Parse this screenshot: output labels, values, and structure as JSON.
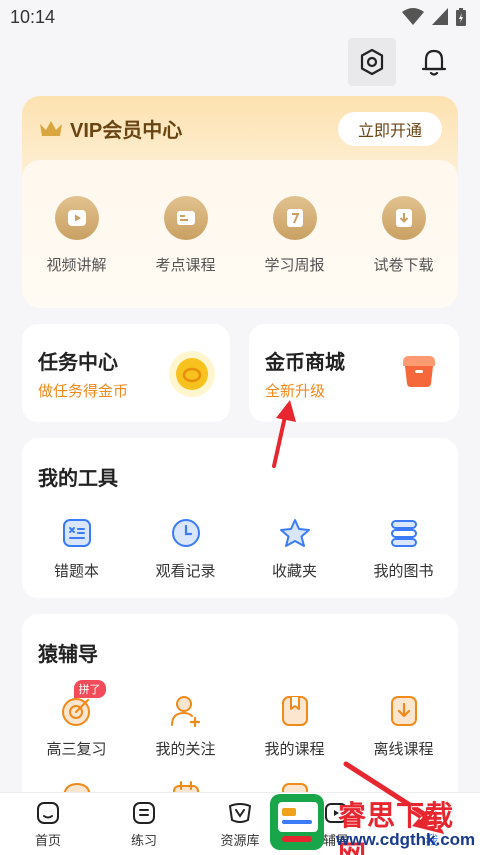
{
  "status": {
    "time": "10:14"
  },
  "vip": {
    "title": "VIP会员中心",
    "open_button": "立即开通",
    "items": [
      {
        "label": "视频讲解",
        "icon": "play-icon"
      },
      {
        "label": "考点课程",
        "icon": "card-icon"
      },
      {
        "label": "学习周报",
        "icon": "calendar-7-icon"
      },
      {
        "label": "试卷下载",
        "icon": "download-icon"
      }
    ]
  },
  "task": {
    "title": "任务中心",
    "subtitle": "做任务得金币"
  },
  "shop": {
    "title": "金币商城",
    "subtitle": "全新升级"
  },
  "tools": {
    "title": "我的工具",
    "items": [
      {
        "label": "错题本",
        "icon": "math-book-icon"
      },
      {
        "label": "观看记录",
        "icon": "clock-icon"
      },
      {
        "label": "收藏夹",
        "icon": "star-icon"
      },
      {
        "label": "我的图书",
        "icon": "books-icon"
      }
    ]
  },
  "guide": {
    "title": "猿辅导",
    "badge": "拼了",
    "items": [
      {
        "label": "高三复习",
        "icon": "target-icon"
      },
      {
        "label": "我的关注",
        "icon": "user-plus-icon"
      },
      {
        "label": "我的课程",
        "icon": "bookmark-icon"
      },
      {
        "label": "离线课程",
        "icon": "download-box-icon"
      }
    ]
  },
  "tabbar": {
    "items": [
      {
        "label": "首页",
        "icon": "home-icon"
      },
      {
        "label": "练习",
        "icon": "practice-icon"
      },
      {
        "label": "资源库",
        "icon": "library-icon"
      },
      {
        "label": "辅导",
        "icon": "tutor-icon"
      },
      {
        "label": "我",
        "icon": "me-icon"
      }
    ]
  },
  "watermark": {
    "title": "睿思下载网",
    "url": "www.cdgthk.com"
  },
  "colors": {
    "accent_orange": "#f08a1a",
    "vip_gold": "#c9a063",
    "tool_blue": "#3b7cf6",
    "guide_orange": "#f08a1a"
  }
}
